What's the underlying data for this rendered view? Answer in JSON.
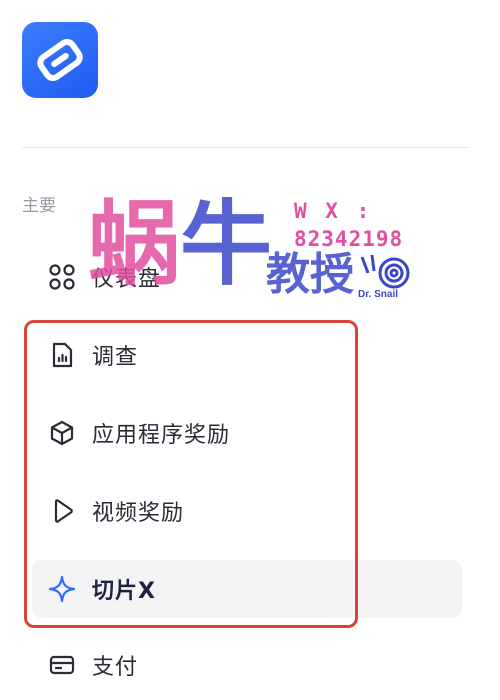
{
  "sidebar": {
    "section_label": "主要",
    "items": [
      {
        "label": "仪表盘",
        "icon": "grid-icon"
      },
      {
        "label": "调查",
        "icon": "survey-document-icon"
      },
      {
        "label": "应用程序奖励",
        "icon": "cube-icon"
      },
      {
        "label": "视频奖励",
        "icon": "play-icon"
      },
      {
        "label": "切片X",
        "icon": "sparkle-icon",
        "active": true
      },
      {
        "label": "支付",
        "icon": "card-icon"
      }
    ]
  },
  "watermark": {
    "big_left": "蜗",
    "big_right": "牛",
    "mid": "教授",
    "wx_label": "W X :",
    "wx_number": "82342198",
    "logo_text": "Dr. Snail"
  },
  "colors": {
    "accent": "#2f6bff",
    "highlight_border": "#d8443a",
    "active_background": "#f4f4f7",
    "icon_active": "#2f6bff",
    "icon_default": "#2b2b38",
    "watermark_pink": "#e24fa0",
    "watermark_blue": "#3b47c8"
  }
}
